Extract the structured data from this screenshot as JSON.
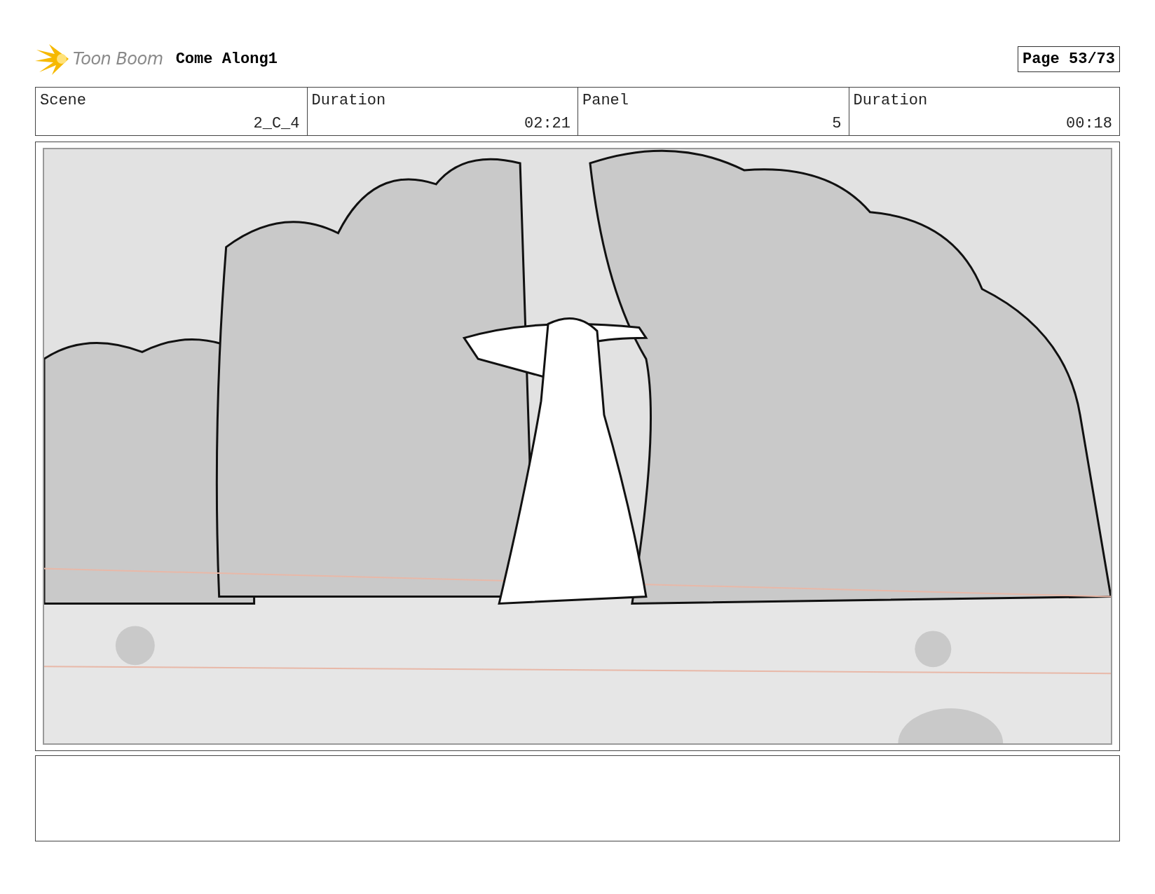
{
  "header": {
    "logo_text": "Toon Boom",
    "title": "Come Along1",
    "page": "Page 53/73"
  },
  "info_table": {
    "columns": [
      "Scene",
      "Duration",
      "Panel",
      "Duration"
    ],
    "rows": [
      [
        "2_C_4",
        "02:21",
        "5",
        "00:18"
      ]
    ]
  }
}
